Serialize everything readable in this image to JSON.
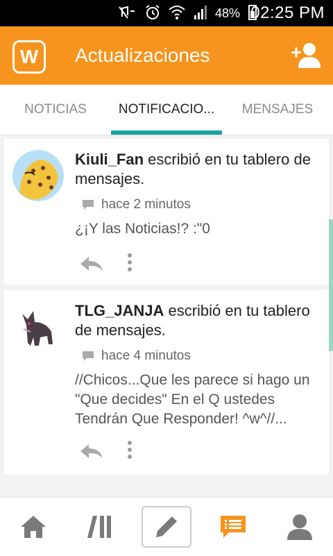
{
  "status_bar": {
    "battery_percent": "48%",
    "time": "02:25 PM"
  },
  "header": {
    "logo_letter": "W",
    "title": "Actualizaciones"
  },
  "tabs": [
    {
      "label": "NOTICIAS",
      "active": false
    },
    {
      "label": "NOTIFICACIO...",
      "active": true
    },
    {
      "label": "MENSAJES",
      "active": false
    }
  ],
  "notifications": [
    {
      "user": "Kiuli_Fan",
      "action": " escribió en tu tablero de mensajes.",
      "time": "hace 2 minutos",
      "message": "¿¡Y las Noticias!? :\"0"
    },
    {
      "user": "TLG_JANJA",
      "action": " escribió en tu tablero de mensajes.",
      "time": "hace 4 minutos",
      "message": "//Chicos...Que les parece si hago un \"Que decides\" En el Q ustedes Tendrán Que Responder! ^w^//..."
    }
  ],
  "colors": {
    "accent": "#f7941d",
    "tab_indicator": "#17a2a3"
  }
}
